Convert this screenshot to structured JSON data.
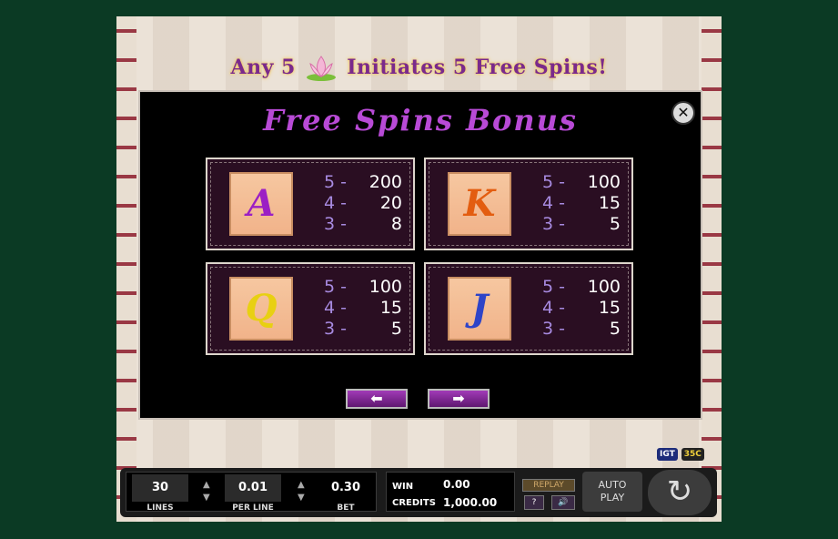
{
  "banner": {
    "left": "Any 5",
    "right": "Initiates 5 Free Spins!"
  },
  "panel": {
    "title": "Free Spins Bonus"
  },
  "cards": [
    {
      "symbol": "A",
      "color": "#9b1fc4",
      "pays": [
        {
          "count": "5 -",
          "value": "200"
        },
        {
          "count": "4 -",
          "value": "20"
        },
        {
          "count": "3 -",
          "value": "8"
        }
      ]
    },
    {
      "symbol": "K",
      "color": "#e35d10",
      "pays": [
        {
          "count": "5 -",
          "value": "100"
        },
        {
          "count": "4 -",
          "value": "15"
        },
        {
          "count": "3 -",
          "value": "5"
        }
      ]
    },
    {
      "symbol": "Q",
      "color": "#e8d012",
      "pays": [
        {
          "count": "5 -",
          "value": "100"
        },
        {
          "count": "4 -",
          "value": "15"
        },
        {
          "count": "3 -",
          "value": "5"
        }
      ]
    },
    {
      "symbol": "J",
      "color": "#2e44c8",
      "pays": [
        {
          "count": "5 -",
          "value": "100"
        },
        {
          "count": "4 -",
          "value": "15"
        },
        {
          "count": "3 -",
          "value": "5"
        }
      ]
    }
  ],
  "nav": {
    "prev": "⬅",
    "next": "➡"
  },
  "logos": {
    "igt": "IGT",
    "studio": "35C"
  },
  "controls": {
    "lines_value": "30",
    "lines_label": "LINES",
    "per_line_value": "0.01",
    "per_line_label": "PER LINE",
    "bet_value": "0.30",
    "bet_label": "BET",
    "win_label": "WIN",
    "win_value": "0.00",
    "credits_label": "CREDITS",
    "credits_value": "1,000.00",
    "replay": "REPLAY",
    "help": "?",
    "sound": "🔊",
    "auto_line1": "AUTO",
    "auto_line2": "PLAY",
    "spin": "↻"
  }
}
